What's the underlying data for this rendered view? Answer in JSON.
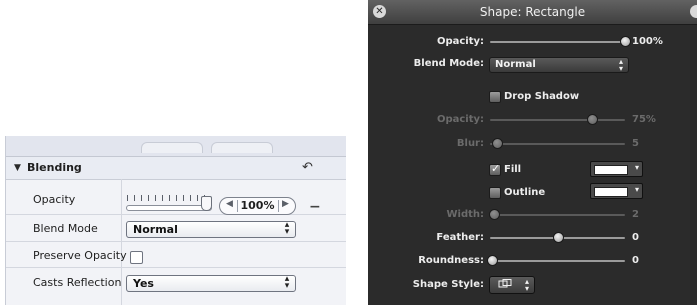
{
  "inspector": {
    "section_title": "Blending",
    "reset_icon": "reset-arrow-icon",
    "opacity_label": "Opacity",
    "opacity_value": "100%",
    "opacity_fraction": 1.0,
    "blend_mode_label": "Blend Mode",
    "blend_mode_value": "Normal",
    "preserve_opacity_label": "Preserve Opacity",
    "preserve_opacity_checked": false,
    "casts_reflection_label": "Casts Reflection",
    "casts_reflection_value": "Yes"
  },
  "hud": {
    "title": "Shape: Rectangle",
    "opacity": {
      "label": "Opacity:",
      "value": "100%",
      "fraction": 1.0
    },
    "blend_mode": {
      "label": "Blend Mode:",
      "value": "Normal"
    },
    "drop_shadow": {
      "label": "Drop Shadow",
      "checked": false
    },
    "shadow_opacity": {
      "label": "Opacity:",
      "value": "75%",
      "fraction": 0.75
    },
    "blur": {
      "label": "Blur:",
      "value": "5",
      "fraction": 0.0
    },
    "fill": {
      "label": "Fill",
      "checked": true,
      "color": "#ffffff"
    },
    "outline": {
      "label": "Outline",
      "checked": false,
      "color": "#ffffff"
    },
    "width": {
      "label": "Width:",
      "value": "2",
      "fraction": 0.0
    },
    "feather": {
      "label": "Feather:",
      "value": "0",
      "fraction": 0.5
    },
    "roundness": {
      "label": "Roundness:",
      "value": "0",
      "fraction": 0.0
    },
    "shape_style": {
      "label": "Shape Style:"
    }
  },
  "colors": {
    "hud_background": "#2b2b2b",
    "inspector_background": "#f2f3f7",
    "dim_text": "#6b6b6b"
  }
}
